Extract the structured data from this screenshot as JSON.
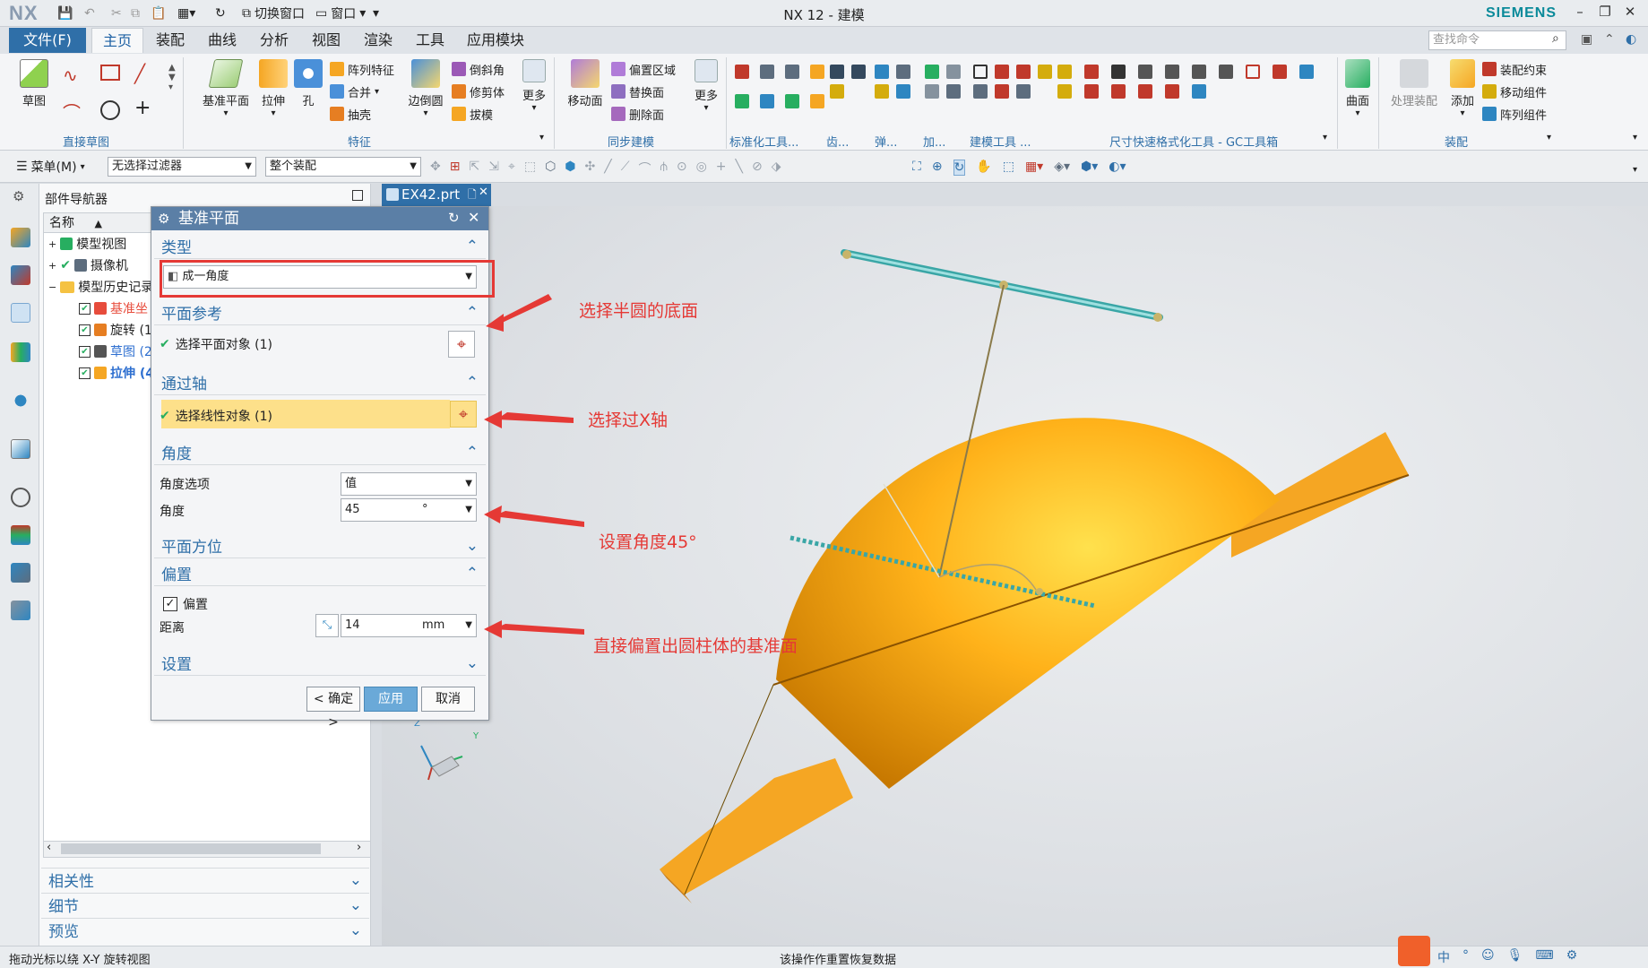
{
  "titlebar": {
    "logo": "NX",
    "window_title": "NX 12 - 建模",
    "brand": "SIEMENS",
    "switch_window": "切换窗口",
    "window_menu": "窗口",
    "minimize": "–",
    "restore": "❐",
    "close": "✕"
  },
  "menu": {
    "file": "文件(F)",
    "tabs": [
      "主页",
      "装配",
      "曲线",
      "分析",
      "视图",
      "渲染",
      "工具",
      "应用模块"
    ],
    "search_placeholder": "查找命令"
  },
  "ribbon": {
    "sketch": "草图",
    "datum_plane": "基准平面",
    "extrude": "拉伸",
    "hole": "孔",
    "pattern_feature": "阵列特征",
    "unite": "合并",
    "shell": "抽壳",
    "edge_blend": "边倒圆",
    "chamfer": "倒斜角",
    "trim_body": "修剪体",
    "draft": "拔模",
    "more": "更多",
    "move_face": "移动面",
    "offset_region": "偏置区域",
    "replace_face": "替换面",
    "delete_face": "删除面",
    "more2": "更多",
    "surface": "曲面",
    "process_assembly": "处理装配",
    "add": "添加",
    "assembly_constraint": "装配约束",
    "move_component": "移动组件",
    "pattern_component": "阵列组件",
    "groups": {
      "direct_sketch": "直接草图",
      "feature": "特征",
      "sync_modeling": "同步建模",
      "std_tools": "标准化工具...",
      "gear": "齿...",
      "spring": "弹...",
      "add": "加...",
      "modeling_tools": "建模工具 ...",
      "dim_tools": "尺寸快速格式化工具 - GC工具箱",
      "assembly": "装配"
    }
  },
  "toolbar2": {
    "menu": "菜单(M)",
    "filter": "无选择过滤器",
    "scope": "整个装配"
  },
  "navigator": {
    "title": "部件导航器",
    "col_name": "名称",
    "items": [
      "模型视图",
      "摄像机",
      "模型历史记录",
      "基准坐",
      "旋转 (1",
      "草图 (2",
      "拉伸 (4"
    ],
    "sections": [
      "相关性",
      "细节",
      "预览"
    ]
  },
  "doc_tab": "EX42.prt",
  "dialog": {
    "title": "基准平面",
    "type_section": "类型",
    "type_value": "成一角度",
    "plane_ref_section": "平面参考",
    "plane_ref_label": "选择平面对象 (1)",
    "through_axis_section": "通过轴",
    "through_axis_label": "选择线性对象 (1)",
    "angle_section": "角度",
    "angle_option_label": "角度选项",
    "angle_option_value": "值",
    "angle_label": "角度",
    "angle_value": "45",
    "angle_unit": "°",
    "plane_orient_section": "平面方位",
    "offset_section": "偏置",
    "offset_check_label": "偏置",
    "distance_label": "距离",
    "distance_value": "14",
    "distance_unit": "mm",
    "settings_section": "设置",
    "ok": "< 确定 >",
    "apply": "应用",
    "cancel": "取消"
  },
  "annotations": {
    "a1": "选择半圆的底面",
    "a2": "选择过X轴",
    "a3": "设置角度45°",
    "a4": "直接偏置出圆柱体的基准面"
  },
  "status": {
    "left": "拖动光标以绕 X-Y 旋转视图",
    "center": "该操作作重置恢复数据"
  },
  "colors": {
    "accent": "#2f6fa8",
    "annotation": "#e53935",
    "solid": "#f5a623",
    "highlight_row": "#fde08a"
  }
}
